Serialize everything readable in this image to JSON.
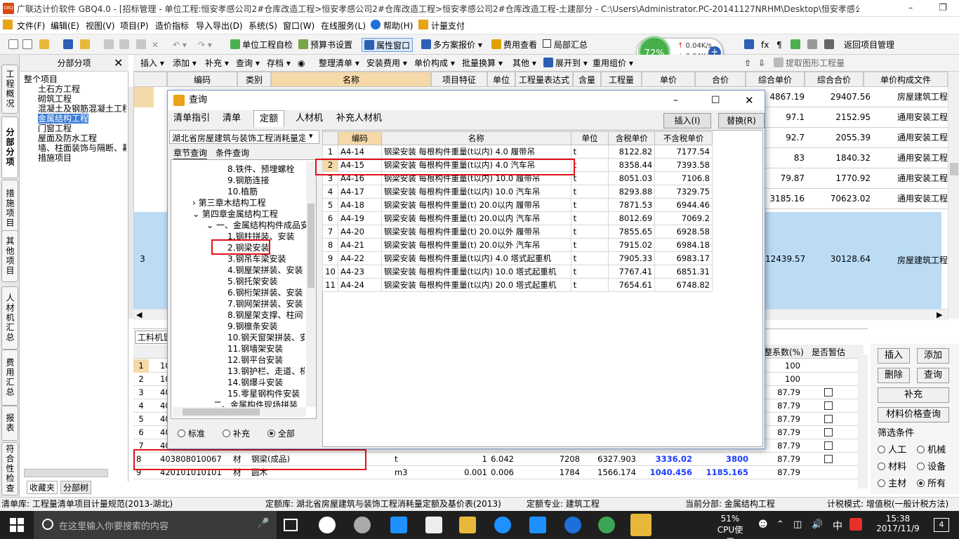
{
  "window": {
    "title": "广联达计价软件 GBQ4.0 - [招标管理 - 单位工程:恒安孝感公司2#仓库改造工程>恒安孝感公司2#仓库改造工程>恒安孝感公司2#仓库改造工程-土建部分 - C:\\Users\\Administrator.PC-20141127NRHM\\Desktop\\恒安孝感公...",
    "app_icon": "GBQ"
  },
  "menu": [
    "文件(F)",
    "编辑(E)",
    "视图(V)",
    "项目(P)",
    "造价指标",
    "导入导出(D)",
    "系统(S)",
    "窗口(W)",
    "在线服务(L)",
    "帮助(H)",
    "计量支付"
  ],
  "ime": {
    "label": "中",
    "indicators": "• 🎤 ⌨ 👤 👕 🔧"
  },
  "toolbar1": {
    "self_check": "单位工程自检",
    "budget_settings": "预算书设置",
    "property_window": "属性窗口",
    "multi_plan": "多方案报价",
    "fee_view": "费用查看",
    "partial_summary": "局部汇总",
    "return_project": "返回项目管理"
  },
  "net_widget": {
    "percent": "72%",
    "up": "0.04K/s",
    "down": "0.04K/s"
  },
  "toolbar2": [
    "插入",
    "添加",
    "补充",
    "查询",
    "存档",
    "整理清单",
    "安装费用",
    "单价构成",
    "批量换算",
    "其他",
    "展开到",
    "重用组价",
    "提取图形工程量"
  ],
  "side_tabs": [
    "工程概况",
    "分部分项",
    "措施项目",
    "其他项目",
    "人材机汇总",
    "费用汇总",
    "报表",
    "符合性检查"
  ],
  "tree": {
    "header": "分部分项",
    "items": [
      "整个项目",
      "土石方工程",
      "砌筑工程",
      "混凝土及钢筋混凝土工程",
      "金属结构工程",
      "门窗工程",
      "屋面及防水工程",
      "墙、柱面装饰与隔断、幕墙",
      "措施项目"
    ],
    "bottom_tabs": [
      "收藏夹",
      "分部树"
    ]
  },
  "grid": {
    "headers": [
      "编码",
      "类别",
      "名称",
      "项目特征",
      "单位",
      "工程量表达式",
      "含量",
      "工程量",
      "单价",
      "合价",
      "综合单价",
      "综合合价",
      "单价构成文件"
    ],
    "rows": [
      {
        "zh": "4867.19",
        "zhhj": "29407.56",
        "file": "房屋建筑工程"
      },
      {
        "zh": "97.1",
        "zhhj": "2152.95",
        "file": "通用安装工程"
      },
      {
        "zh": "92.7",
        "zhhj": "2055.39",
        "file": "通用安装工程"
      },
      {
        "zh": "83",
        "zhhj": "1840.32",
        "file": "通用安装工程"
      },
      {
        "zh": "79.87",
        "zhhj": "1770.92",
        "file": "通用安装工程"
      },
      {
        "zh": "3185.16",
        "zhhj": "70623.02",
        "file": "通用安装工程"
      }
    ],
    "big_row": {
      "no": "3",
      "zh": "12439.57",
      "zhhj": "30128.64",
      "file": "房屋建筑工程"
    }
  },
  "dialog": {
    "title": "查询",
    "tabs": [
      "清单指引",
      "清单",
      "定额",
      "人材机",
      "补充人材机"
    ],
    "active_tab": "定额",
    "insert_btn": "插入(I)",
    "replace_btn": "替换(R)",
    "library": "湖北省房屋建筑与装饰工程消耗量定额",
    "subtabs": [
      "章节查询",
      "条件查询"
    ],
    "chapter_tree": [
      "8.铁件、预埋螺栓",
      "9.钢筋连接",
      "10.植筋",
      "第三章木结构工程",
      "第四章金属结构工程",
      "一、金属结构构件成品安",
      "1.钢柱拼装、安装",
      "2.钢梁安装",
      "3.钢吊车梁安装",
      "4.钢屋架拼装、安装",
      "5.钢托架安装",
      "6.钢桁架拼装、安装",
      "7.钢网架拼装、安装",
      "8.钢屋架支撑、柱间",
      "9.钢檩条安装",
      "10.钢天窗架拼装、安",
      "11.钢墙架安装",
      "12.钢平台安装",
      "13.钢护栏、走道、梯",
      "14.钢爆斗安装",
      "15.零星钢构件安装",
      "二、金属构件现场拼装"
    ],
    "radio": [
      "标准",
      "补充",
      "全部"
    ],
    "radio_selected": "全部",
    "table_headers": [
      "",
      "编码",
      "名称",
      "单位",
      "含税单价",
      "不含税单价"
    ],
    "rows": [
      [
        "1",
        "A4-14",
        "钢梁安装 每根构件重量(t以内) 4.0 履带吊",
        "t",
        "8122.82",
        "7177.54"
      ],
      [
        "2",
        "A4-15",
        "钢梁安装 每根构件重量(t以内) 4.0 汽车吊",
        "t",
        "8358.44",
        "7393.58"
      ],
      [
        "3",
        "A4-16",
        "钢梁安装 每根构件重量(t以内) 10.0 履带吊",
        "t",
        "8051.03",
        "7106.8"
      ],
      [
        "4",
        "A4-17",
        "钢梁安装 每根构件重量(t以内) 10.0 汽车吊",
        "t",
        "8293.88",
        "7329.75"
      ],
      [
        "5",
        "A4-18",
        "钢梁安装 每根构件重量(t) 20.0以内 履带吊",
        "t",
        "7871.53",
        "6944.46"
      ],
      [
        "6",
        "A4-19",
        "钢梁安装 每根构件重量(t) 20.0以内 汽车吊",
        "t",
        "8012.69",
        "7069.2"
      ],
      [
        "7",
        "A4-20",
        "钢梁安装 每根构件重量(t) 20.0以外 履带吊",
        "t",
        "7855.65",
        "6928.58"
      ],
      [
        "8",
        "A4-21",
        "钢梁安装 每根构件重量(t) 20.0以外 汽车吊",
        "t",
        "7915.02",
        "6984.18"
      ],
      [
        "9",
        "A4-22",
        "钢梁安装 每根构件重量(t以内) 4.0 塔式起重机",
        "t",
        "7905.33",
        "6983.17"
      ],
      [
        "10",
        "A4-23",
        "钢梁安装 每根构件重量(t以内) 10.0 塔式起重机",
        "t",
        "7767.41",
        "6851.31"
      ],
      [
        "11",
        "A4-24",
        "钢梁安装 每根构件重量(t以内) 20.0 塔式起重机",
        "t",
        "7654.61",
        "6748.82"
      ]
    ]
  },
  "lower_grid": {
    "tab": "工料机显",
    "hdr_adj": "整系数(%)",
    "hdr_temp": "是否暂估",
    "rows": [
      {
        "no": "1",
        "code": "10",
        "adj": "100",
        "chk": false
      },
      {
        "no": "2",
        "code": "10",
        "adj": "100",
        "chk": false
      },
      {
        "no": "3",
        "code": "40",
        "adj": "87.79",
        "chk": true
      },
      {
        "no": "4",
        "code": "40",
        "adj": "87.79",
        "chk": true
      },
      {
        "no": "5",
        "code": "40",
        "adj": "87.79",
        "chk": true
      },
      {
        "no": "6",
        "code": "40",
        "adj": "87.79",
        "chk": true
      },
      {
        "no": "7",
        "code": "40",
        "adj": "87.79",
        "chk": true
      }
    ],
    "row8": {
      "no": "8",
      "code": "403808010067",
      "type": "材",
      "name": "钢梁(成品)",
      "unit": "t",
      "c1": "1",
      "c2": "6.042",
      "c3": "7208",
      "c4": "6327.903",
      "c5": "3336.02",
      "c6": "3800",
      "adj": "87.79"
    },
    "row9": {
      "no": "9",
      "code": "420101010101",
      "type": "材",
      "name": "圆木",
      "unit": "m3",
      "c1": "0.001",
      "c2": "0.006",
      "c3": "1784",
      "c4": "1566.174",
      "c5": "1040.456",
      "c6": "1185.165",
      "adj": "87.79"
    }
  },
  "right_panel": {
    "insert": "插入",
    "add": "添加",
    "delete": "删除",
    "query": "查询",
    "supplement": "补充",
    "price_query": "材料价格查询",
    "filter_title": "筛选条件",
    "filters": [
      "人工",
      "机械",
      "材料",
      "设备",
      "主材",
      "所有"
    ],
    "filter_selected": "所有"
  },
  "status": {
    "list_lib": "清单库: 工程量清单项目计量规范(2013-湖北)",
    "quota_lib": "定额库: 湖北省房屋建筑与装饰工程消耗量定额及基价表(2013)",
    "quota_major": "定额专业: 建筑工程",
    "current_part": "当前分部: 金属结构工程",
    "tax_mode": "计税模式: 增值税(一般计税方法)"
  },
  "taskbar": {
    "search_placeholder": "在这里输入你要搜索的内容",
    "cpu": "51%",
    "cpu_label": "CPU使用",
    "lang": "中",
    "time": "15:38",
    "date": "2017/11/9",
    "notify": "4"
  },
  "colors": {
    "accent": "#3a7bd5",
    "red": "#e0121b",
    "blue_text": "#1a3cff",
    "selected_row": "#bcdcf5",
    "taskbar": "#1f1f1f"
  }
}
